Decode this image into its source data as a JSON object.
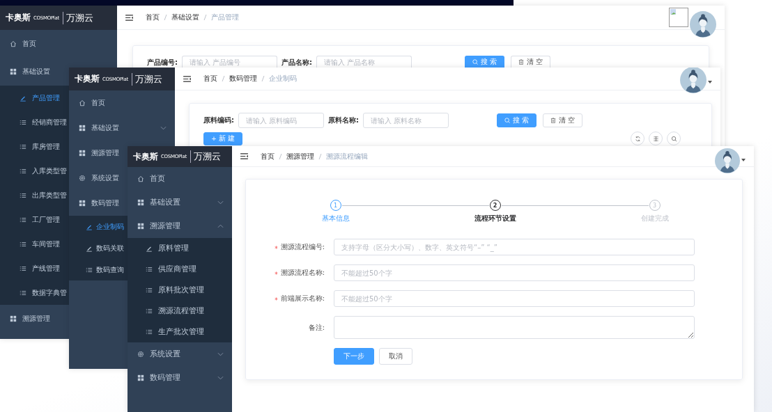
{
  "windows": [
    {
      "logo": {
        "brand": "卡奥斯",
        "mark": "COSMOPlat",
        "product": "万溯云"
      },
      "breadcrumb": [
        "首页",
        "基础设置",
        "产品管理"
      ],
      "sidebar": [
        {
          "label": "首页",
          "kind": "home"
        },
        {
          "label": "基础设置",
          "kind": "group",
          "children": [
            {
              "label": "产品管理",
              "kind": "edit",
              "selected": true
            },
            {
              "label": "经销商管理",
              "kind": "list",
              "selected": false
            },
            {
              "label": "库房管理",
              "kind": "list",
              "selected": false
            },
            {
              "label": "入库类型管",
              "kind": "list",
              "selected": false
            },
            {
              "label": "出库类型管",
              "kind": "list",
              "selected": false
            },
            {
              "label": "工厂管理",
              "kind": "list",
              "selected": false
            },
            {
              "label": "车间管理",
              "kind": "list",
              "selected": false
            },
            {
              "label": "产线管理",
              "kind": "list",
              "selected": false
            },
            {
              "label": "数据字典管",
              "kind": "list",
              "selected": false
            }
          ]
        },
        {
          "label": "溯源管理",
          "kind": "group"
        }
      ],
      "content": {
        "kind": "search",
        "fields": [
          {
            "label": "产品编号:",
            "placeholder": "请输入 产品编号"
          },
          {
            "label": "产品名称:",
            "placeholder": "请输入 产品名称"
          }
        ],
        "buttons": [
          {
            "label": "搜 索",
            "kind": "search"
          },
          {
            "label": "清 空",
            "kind": "clear"
          }
        ]
      }
    },
    {
      "logo": {
        "brand": "卡奥斯",
        "mark": "COSMOPlat",
        "product": "万溯云"
      },
      "breadcrumb": [
        "首页",
        "数码管理",
        "企业制码"
      ],
      "sidebar": [
        {
          "label": "首页",
          "kind": "home"
        },
        {
          "label": "基础设置",
          "kind": "group",
          "expanded": false
        },
        {
          "label": "溯源管理",
          "kind": "group"
        },
        {
          "label": "系统设置",
          "kind": "settings"
        },
        {
          "label": "数码管理",
          "kind": "group",
          "children": [
            {
              "label": "企业制码",
              "kind": "edit",
              "selected": true
            },
            {
              "label": "数码关联",
              "kind": "edit",
              "selected": false
            },
            {
              "label": "数码查询",
              "kind": "list",
              "selected": false
            }
          ]
        }
      ],
      "content": {
        "kind": "search",
        "fields": [
          {
            "label": "原料编码:",
            "placeholder": "请输入 原料编码"
          },
          {
            "label": "原料名称:",
            "placeholder": "请输入 原料名称"
          }
        ],
        "buttons": [
          {
            "label": "搜 索",
            "kind": "search"
          },
          {
            "label": "清 空",
            "kind": "clear"
          }
        ],
        "actions": [
          {
            "label": "+ 新 建",
            "kind": "create"
          }
        ]
      }
    },
    {
      "logo": {
        "brand": "卡奥斯",
        "mark": "COSMOPlat",
        "product": "万溯云"
      },
      "breadcrumb": [
        "首页",
        "溯源管理",
        "溯源流程编辑"
      ],
      "sidebar": [
        {
          "label": "首页",
          "kind": "home"
        },
        {
          "label": "基础设置",
          "kind": "group",
          "expanded": false
        },
        {
          "label": "溯源管理",
          "kind": "group",
          "expanded": true,
          "children": [
            {
              "label": "原料管理",
              "kind": "edit",
              "selected": false
            },
            {
              "label": "供应商管理",
              "kind": "list",
              "selected": false
            },
            {
              "label": "原料批次管理",
              "kind": "list",
              "selected": false
            },
            {
              "label": "溯源流程管理",
              "kind": "list",
              "selected": false
            },
            {
              "label": "生产批次管理",
              "kind": "list",
              "selected": false
            }
          ]
        },
        {
          "label": "系统设置",
          "kind": "settings",
          "expanded": false
        },
        {
          "label": "数码管理",
          "kind": "group",
          "expanded": false
        }
      ],
      "content": {
        "kind": "steps",
        "steps": [
          {
            "number": "1",
            "label": "基本信息",
            "done": true,
            "selected": false
          },
          {
            "number": "2",
            "label": "流程环节设置",
            "done": false,
            "selected": true
          },
          {
            "number": "3",
            "label": "创建完成",
            "done": false,
            "selected": false
          }
        ],
        "fields": [
          {
            "label": "溯源流程编号:",
            "required": true,
            "kind": "input",
            "placeholder": "支持字母（区分大小写）、数字、英文符号“–” “_”"
          },
          {
            "label": "溯源流程名称:",
            "required": true,
            "kind": "input",
            "placeholder": "不能超过50个字"
          },
          {
            "label": "前端展示名称:",
            "required": true,
            "kind": "input",
            "placeholder": "不能超过50个字"
          },
          {
            "label": "备注:",
            "required": false,
            "kind": "textarea"
          }
        ],
        "buttons": [
          {
            "label": "下一步",
            "kind": "next"
          },
          {
            "label": "取消",
            "kind": "cancel"
          }
        ]
      }
    }
  ]
}
